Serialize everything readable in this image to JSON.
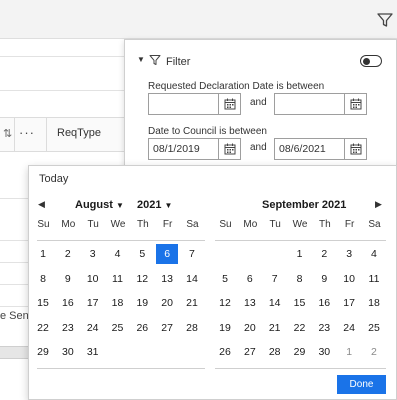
{
  "grid": {
    "sort_glyph": "⇅",
    "dots": "···",
    "column_header": "ReqType",
    "partial_cell_text": "e Sen"
  },
  "filter": {
    "title": "Filter",
    "toggle_on": false,
    "requested_label": "Requested Declaration Date is between",
    "requested_from_value": "",
    "requested_to_value": "",
    "council_label": "Date to Council is between",
    "council_from_value": "08/1/2019",
    "council_to_value": "08/6/2021",
    "and_label": "and"
  },
  "calendar": {
    "today_label": "Today",
    "left": {
      "month": "August",
      "year": "2021",
      "weekdays": [
        "Su",
        "Mo",
        "Tu",
        "We",
        "Th",
        "Fr",
        "Sa"
      ],
      "weeks": [
        [
          [
            "1",
            "cur"
          ],
          [
            "2",
            "cur"
          ],
          [
            "3",
            "cur"
          ],
          [
            "4",
            "cur"
          ],
          [
            "5",
            "cur"
          ],
          [
            "6",
            "sel"
          ],
          [
            "7",
            "cur"
          ]
        ],
        [
          [
            "8",
            "cur"
          ],
          [
            "9",
            "cur"
          ],
          [
            "10",
            "cur"
          ],
          [
            "11",
            "cur"
          ],
          [
            "12",
            "cur"
          ],
          [
            "13",
            "cur"
          ],
          [
            "14",
            "cur"
          ]
        ],
        [
          [
            "15",
            "cur"
          ],
          [
            "16",
            "cur"
          ],
          [
            "17",
            "cur"
          ],
          [
            "18",
            "cur"
          ],
          [
            "19",
            "cur"
          ],
          [
            "20",
            "cur"
          ],
          [
            "21",
            "cur"
          ]
        ],
        [
          [
            "22",
            "cur"
          ],
          [
            "23",
            "cur"
          ],
          [
            "24",
            "cur"
          ],
          [
            "25",
            "cur"
          ],
          [
            "26",
            "cur"
          ],
          [
            "27",
            "cur"
          ],
          [
            "28",
            "cur"
          ]
        ],
        [
          [
            "29",
            "cur"
          ],
          [
            "30",
            "cur"
          ],
          [
            "31",
            "cur"
          ],
          [
            "",
            "empty"
          ],
          [
            "",
            "empty"
          ],
          [
            "",
            "empty"
          ],
          [
            "",
            "empty"
          ]
        ]
      ]
    },
    "right": {
      "title": "September 2021",
      "weekdays": [
        "Su",
        "Mo",
        "Tu",
        "We",
        "Th",
        "Fr",
        "Sa"
      ],
      "weeks": [
        [
          [
            "",
            "empty"
          ],
          [
            "",
            "empty"
          ],
          [
            "",
            "empty"
          ],
          [
            "1",
            "cur"
          ],
          [
            "2",
            "cur"
          ],
          [
            "3",
            "cur"
          ],
          [
            "4",
            "cur"
          ]
        ],
        [
          [
            "5",
            "cur"
          ],
          [
            "6",
            "cur"
          ],
          [
            "7",
            "cur"
          ],
          [
            "8",
            "cur"
          ],
          [
            "9",
            "cur"
          ],
          [
            "10",
            "cur"
          ],
          [
            "11",
            "cur"
          ]
        ],
        [
          [
            "12",
            "cur"
          ],
          [
            "13",
            "cur"
          ],
          [
            "14",
            "cur"
          ],
          [
            "15",
            "cur"
          ],
          [
            "16",
            "cur"
          ],
          [
            "17",
            "cur"
          ],
          [
            "18",
            "cur"
          ]
        ],
        [
          [
            "19",
            "cur"
          ],
          [
            "20",
            "cur"
          ],
          [
            "21",
            "cur"
          ],
          [
            "22",
            "cur"
          ],
          [
            "23",
            "cur"
          ],
          [
            "24",
            "cur"
          ],
          [
            "25",
            "cur"
          ]
        ],
        [
          [
            "26",
            "cur"
          ],
          [
            "27",
            "cur"
          ],
          [
            "28",
            "cur"
          ],
          [
            "29",
            "cur"
          ],
          [
            "30",
            "cur"
          ],
          [
            "1",
            "muted"
          ],
          [
            "2",
            "muted"
          ]
        ]
      ]
    },
    "done_label": "Done",
    "accent_color": "#1a73e8"
  },
  "icons": {
    "toolbar_filter": "filter-icon",
    "panel_filter": "filter-icon",
    "calendar_button": "calendar-icon",
    "prev": "chevron-left-icon",
    "next": "chevron-right-icon",
    "caret": "caret-down-icon"
  }
}
